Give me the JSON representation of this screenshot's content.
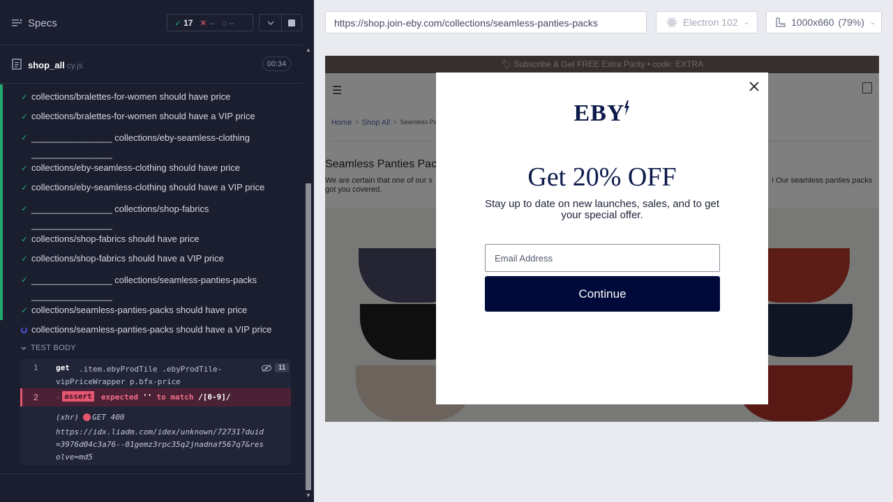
{
  "reporter": {
    "title": "Specs",
    "stats": {
      "passed": "17",
      "failed": "--",
      "pending": "--"
    },
    "file": {
      "name": "shop_all",
      "ext": "cy.js",
      "duration": "00:34"
    },
    "tests": [
      {
        "status": "passed",
        "title": "collections/bralettes-for-women should have price"
      },
      {
        "status": "passed",
        "title": "collections/bralettes-for-women should have a VIP price"
      },
      {
        "status": "passed",
        "title": "________________ collections/eby-seamless-clothing ________________"
      },
      {
        "status": "passed",
        "title": "collections/eby-seamless-clothing should have price"
      },
      {
        "status": "passed",
        "title": "collections/eby-seamless-clothing should have a VIP price"
      },
      {
        "status": "passed",
        "title": "________________ collections/shop-fabrics ________________"
      },
      {
        "status": "passed",
        "title": "collections/shop-fabrics should have price"
      },
      {
        "status": "passed",
        "title": "collections/shop-fabrics should have a VIP price"
      },
      {
        "status": "passed",
        "title": "________________ collections/seamless-panties-packs ________________"
      },
      {
        "status": "passed",
        "title": "collections/seamless-panties-packs should have price"
      },
      {
        "status": "running",
        "title": "collections/seamless-panties-packs should have a VIP price"
      }
    ],
    "test_body_label": "TEST BODY",
    "commands": [
      {
        "number": "1",
        "name": "get",
        "message": ".item.ebyProdTile .ebyProdTile-vipPriceWrapper p.bfx-price",
        "count": "11"
      },
      {
        "number": "2",
        "prefix": "-",
        "name": "assert",
        "message_pre": "expected",
        "message_mid": "''",
        "message_to": "to match",
        "message_pattern": "/[0-9]/"
      }
    ],
    "xhr": {
      "type": "(xhr)",
      "method_status": "GET 400",
      "url": "https://idx.liadm.com/idex/unknown/72731?duid=3976d04c3a76--01gemz3rpc35q2jnadnaf567q7&resolve=md5"
    }
  },
  "aut": {
    "url": "https://shop.join-eby.com/collections/seamless-panties-packs",
    "browser": "Electron 102",
    "viewport": "1000x660",
    "viewport_scale": "(79%)",
    "page": {
      "promo": "🏷 Subscribe & Get FREE Extra Panty • code: EXTRA",
      "breadcrumbs": [
        "Home",
        "Shop All",
        "Seamless Pa"
      ],
      "heading": "Seamless Panties Pac",
      "description_left": "We are certain that one of our s",
      "description_right": "! Our seamless panties packs",
      "description_line2": "got you covered."
    },
    "modal": {
      "logo": "EBY",
      "title": "Get 20% OFF",
      "subtitle": "Stay up to date on new launches, sales, and to get your special offer.",
      "email_placeholder": "Email Address",
      "continue_label": "Continue"
    }
  },
  "colors": {
    "reporter_bg": "#1b1e2e",
    "pass": "#1fa971",
    "fail": "#e45770",
    "running": "#4956e3",
    "modal_brand": "#0c1a4a",
    "continue_bg": "#000a3a"
  }
}
